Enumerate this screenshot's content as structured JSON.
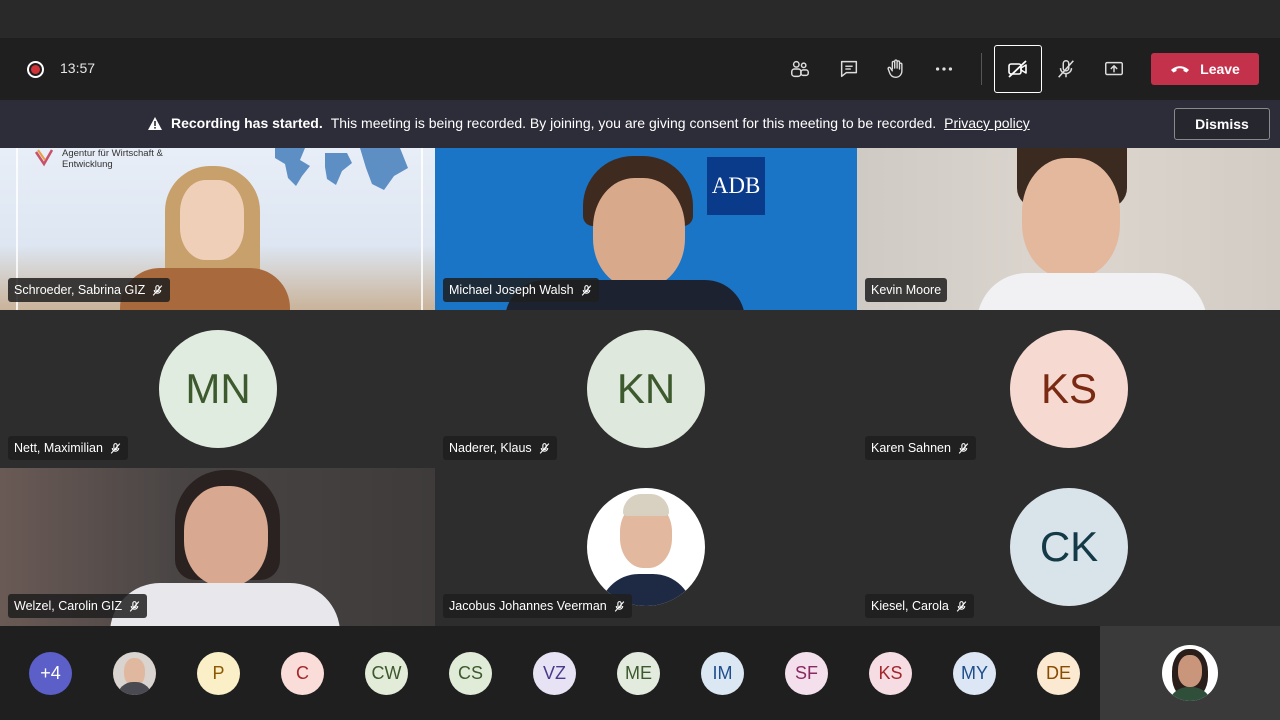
{
  "toolbar": {
    "timer": "13:57",
    "leave_label": "Leave"
  },
  "banner": {
    "bold": "Recording has started.",
    "text": "This meeting is being recorded. By joining, you are giving consent for this meeting to be recorded.",
    "link": "Privacy policy",
    "dismiss": "Dismiss"
  },
  "tiles": [
    {
      "name": "Schroeder, Sabrina GIZ",
      "type": "video"
    },
    {
      "name": "Michael Joseph Walsh",
      "type": "video",
      "logo": "ADB"
    },
    {
      "name": "Kevin Moore",
      "type": "video"
    },
    {
      "name": "Nett, Maximilian",
      "initials": "MN",
      "bg": "#e1ece0",
      "fg": "#3c5a2d"
    },
    {
      "name": "Naderer, Klaus",
      "initials": "KN",
      "bg": "#dfe8dc",
      "fg": "#3c5a2d"
    },
    {
      "name": "Karen Sahnen",
      "initials": "KS",
      "bg": "#f6d9d0",
      "fg": "#7a2a12"
    },
    {
      "name": "Welzel, Carolin GIZ",
      "type": "video"
    },
    {
      "name": "Jacobus Johannes Veerman",
      "type": "photo"
    },
    {
      "name": "Kiesel, Carola",
      "initials": "CK",
      "bg": "#d8e4ea",
      "fg": "#143a48"
    }
  ],
  "sign_logo_text": "Agentur für Wirtschaft & Entwicklung",
  "roster": [
    {
      "label": "+4",
      "bg": "#5b5fc7",
      "fg": "#ffffff"
    },
    {
      "label": "",
      "photo": true,
      "bg": "#d9d4cf",
      "fg": "#333333"
    },
    {
      "label": "P",
      "bg": "#fbefc8",
      "fg": "#8a5a00"
    },
    {
      "label": "C",
      "bg": "#fadcd8",
      "fg": "#a4262c"
    },
    {
      "label": "CW",
      "bg": "#e3ecd8",
      "fg": "#3c5a2d"
    },
    {
      "label": "CS",
      "bg": "#e0ecd8",
      "fg": "#3c5a2d"
    },
    {
      "label": "VZ",
      "bg": "#e7e3f4",
      "fg": "#4b3a8c"
    },
    {
      "label": "ME",
      "bg": "#e2ebdd",
      "fg": "#3c5a2d"
    },
    {
      "label": "IM",
      "bg": "#dce7f4",
      "fg": "#1f4e8c"
    },
    {
      "label": "SF",
      "bg": "#f4e0ec",
      "fg": "#8a2a62"
    },
    {
      "label": "KS",
      "bg": "#f6dde3",
      "fg": "#a4262c"
    },
    {
      "label": "MY",
      "bg": "#dce6f4",
      "fg": "#1f4e8c"
    },
    {
      "label": "DE",
      "bg": "#fbe9d2",
      "fg": "#8a4a00"
    }
  ]
}
